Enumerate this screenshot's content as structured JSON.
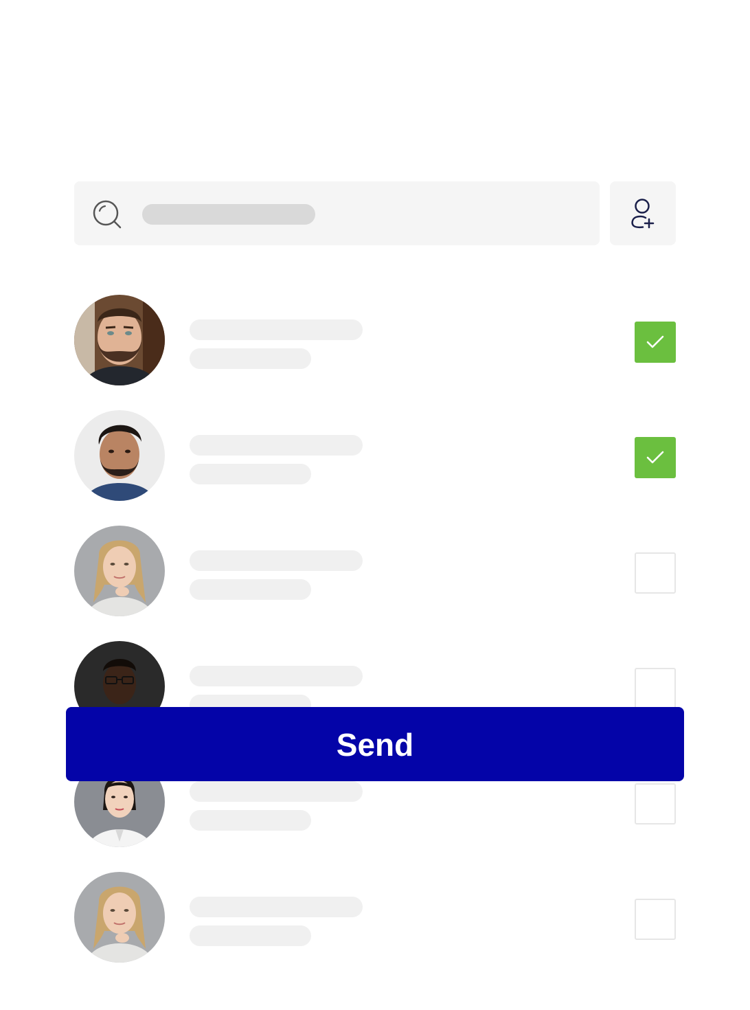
{
  "search": {
    "icon": "search-icon",
    "placeholder_text": ""
  },
  "add_contact": {
    "icon": "add-user-icon"
  },
  "contacts": [
    {
      "checked": true,
      "avatar": "bearded-man-photo"
    },
    {
      "checked": true,
      "avatar": "man-with-beard-photo"
    },
    {
      "checked": false,
      "avatar": "blonde-woman-photo"
    },
    {
      "checked": false,
      "avatar": "man-in-suit-photo"
    },
    {
      "checked": false,
      "avatar": "woman-in-white-shirt-photo"
    },
    {
      "checked": false,
      "avatar": "blonde-woman-photo"
    }
  ],
  "send_button": {
    "label": "Send"
  },
  "colors": {
    "accent": "#0404A8",
    "checked": "#6BBF3F",
    "skeleton": "#F0F0F0",
    "search_bg": "#F5F5F5"
  }
}
